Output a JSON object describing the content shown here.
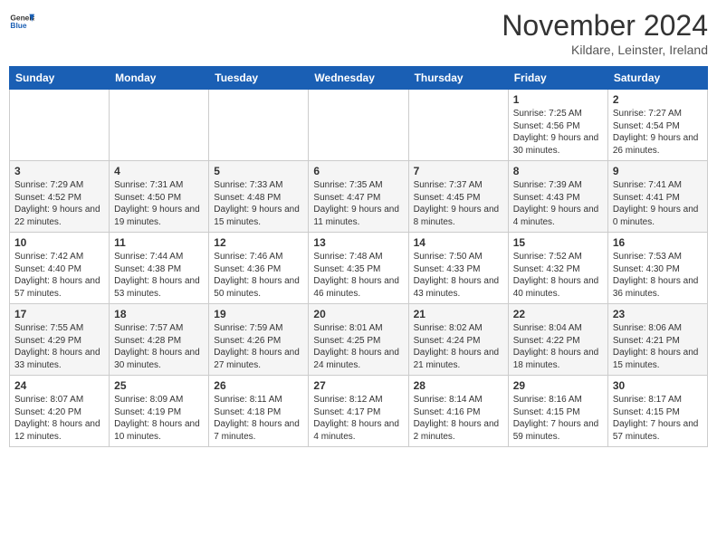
{
  "header": {
    "logo": {
      "general": "General",
      "blue": "Blue"
    },
    "title": "November 2024",
    "subtitle": "Kildare, Leinster, Ireland"
  },
  "weekdays": [
    "Sunday",
    "Monday",
    "Tuesday",
    "Wednesday",
    "Thursday",
    "Friday",
    "Saturday"
  ],
  "weeks": [
    [
      {
        "day": "",
        "info": ""
      },
      {
        "day": "",
        "info": ""
      },
      {
        "day": "",
        "info": ""
      },
      {
        "day": "",
        "info": ""
      },
      {
        "day": "",
        "info": ""
      },
      {
        "day": "1",
        "info": "Sunrise: 7:25 AM\nSunset: 4:56 PM\nDaylight: 9 hours and 30 minutes."
      },
      {
        "day": "2",
        "info": "Sunrise: 7:27 AM\nSunset: 4:54 PM\nDaylight: 9 hours and 26 minutes."
      }
    ],
    [
      {
        "day": "3",
        "info": "Sunrise: 7:29 AM\nSunset: 4:52 PM\nDaylight: 9 hours and 22 minutes."
      },
      {
        "day": "4",
        "info": "Sunrise: 7:31 AM\nSunset: 4:50 PM\nDaylight: 9 hours and 19 minutes."
      },
      {
        "day": "5",
        "info": "Sunrise: 7:33 AM\nSunset: 4:48 PM\nDaylight: 9 hours and 15 minutes."
      },
      {
        "day": "6",
        "info": "Sunrise: 7:35 AM\nSunset: 4:47 PM\nDaylight: 9 hours and 11 minutes."
      },
      {
        "day": "7",
        "info": "Sunrise: 7:37 AM\nSunset: 4:45 PM\nDaylight: 9 hours and 8 minutes."
      },
      {
        "day": "8",
        "info": "Sunrise: 7:39 AM\nSunset: 4:43 PM\nDaylight: 9 hours and 4 minutes."
      },
      {
        "day": "9",
        "info": "Sunrise: 7:41 AM\nSunset: 4:41 PM\nDaylight: 9 hours and 0 minutes."
      }
    ],
    [
      {
        "day": "10",
        "info": "Sunrise: 7:42 AM\nSunset: 4:40 PM\nDaylight: 8 hours and 57 minutes."
      },
      {
        "day": "11",
        "info": "Sunrise: 7:44 AM\nSunset: 4:38 PM\nDaylight: 8 hours and 53 minutes."
      },
      {
        "day": "12",
        "info": "Sunrise: 7:46 AM\nSunset: 4:36 PM\nDaylight: 8 hours and 50 minutes."
      },
      {
        "day": "13",
        "info": "Sunrise: 7:48 AM\nSunset: 4:35 PM\nDaylight: 8 hours and 46 minutes."
      },
      {
        "day": "14",
        "info": "Sunrise: 7:50 AM\nSunset: 4:33 PM\nDaylight: 8 hours and 43 minutes."
      },
      {
        "day": "15",
        "info": "Sunrise: 7:52 AM\nSunset: 4:32 PM\nDaylight: 8 hours and 40 minutes."
      },
      {
        "day": "16",
        "info": "Sunrise: 7:53 AM\nSunset: 4:30 PM\nDaylight: 8 hours and 36 minutes."
      }
    ],
    [
      {
        "day": "17",
        "info": "Sunrise: 7:55 AM\nSunset: 4:29 PM\nDaylight: 8 hours and 33 minutes."
      },
      {
        "day": "18",
        "info": "Sunrise: 7:57 AM\nSunset: 4:28 PM\nDaylight: 8 hours and 30 minutes."
      },
      {
        "day": "19",
        "info": "Sunrise: 7:59 AM\nSunset: 4:26 PM\nDaylight: 8 hours and 27 minutes."
      },
      {
        "day": "20",
        "info": "Sunrise: 8:01 AM\nSunset: 4:25 PM\nDaylight: 8 hours and 24 minutes."
      },
      {
        "day": "21",
        "info": "Sunrise: 8:02 AM\nSunset: 4:24 PM\nDaylight: 8 hours and 21 minutes."
      },
      {
        "day": "22",
        "info": "Sunrise: 8:04 AM\nSunset: 4:22 PM\nDaylight: 8 hours and 18 minutes."
      },
      {
        "day": "23",
        "info": "Sunrise: 8:06 AM\nSunset: 4:21 PM\nDaylight: 8 hours and 15 minutes."
      }
    ],
    [
      {
        "day": "24",
        "info": "Sunrise: 8:07 AM\nSunset: 4:20 PM\nDaylight: 8 hours and 12 minutes."
      },
      {
        "day": "25",
        "info": "Sunrise: 8:09 AM\nSunset: 4:19 PM\nDaylight: 8 hours and 10 minutes."
      },
      {
        "day": "26",
        "info": "Sunrise: 8:11 AM\nSunset: 4:18 PM\nDaylight: 8 hours and 7 minutes."
      },
      {
        "day": "27",
        "info": "Sunrise: 8:12 AM\nSunset: 4:17 PM\nDaylight: 8 hours and 4 minutes."
      },
      {
        "day": "28",
        "info": "Sunrise: 8:14 AM\nSunset: 4:16 PM\nDaylight: 8 hours and 2 minutes."
      },
      {
        "day": "29",
        "info": "Sunrise: 8:16 AM\nSunset: 4:15 PM\nDaylight: 7 hours and 59 minutes."
      },
      {
        "day": "30",
        "info": "Sunrise: 8:17 AM\nSunset: 4:15 PM\nDaylight: 7 hours and 57 minutes."
      }
    ]
  ]
}
